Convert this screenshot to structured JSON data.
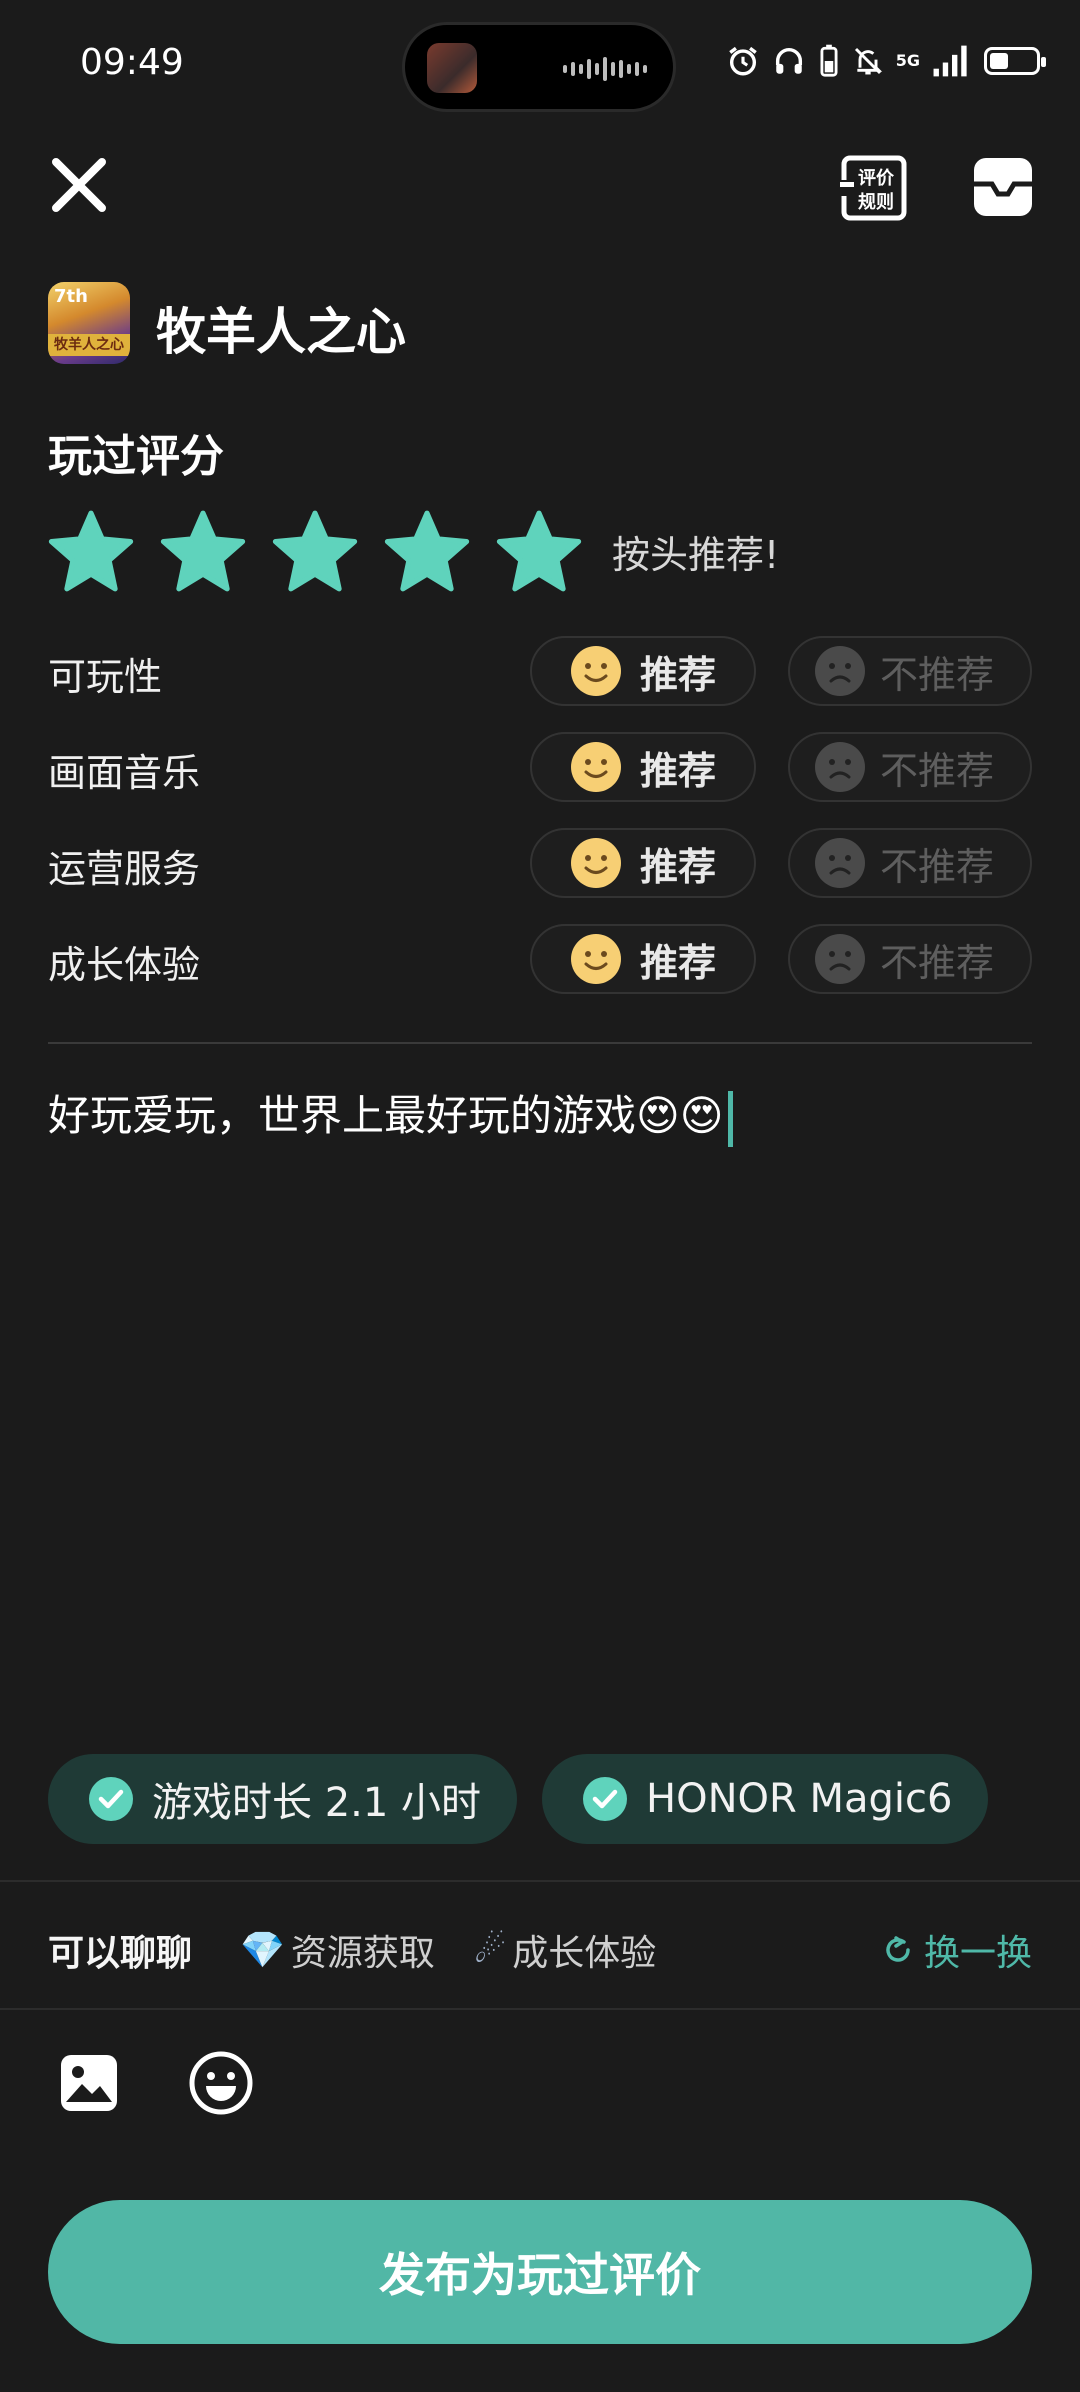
{
  "status_bar": {
    "time": "09:49",
    "network": "5G"
  },
  "game": {
    "title": "牧羊人之心",
    "icon_badge": "7th",
    "icon_caption": "牧羊人之心"
  },
  "rating": {
    "section_title": "玩过评分",
    "stars": 5,
    "max_stars": 5,
    "hint": "按头推荐!",
    "accent_color": "#5fd3bc"
  },
  "aspects": [
    {
      "label": "可玩性",
      "yes_label": "推荐",
      "no_label": "不推荐",
      "selected": "yes"
    },
    {
      "label": "画面音乐",
      "yes_label": "推荐",
      "no_label": "不推荐",
      "selected": "yes"
    },
    {
      "label": "运营服务",
      "yes_label": "推荐",
      "no_label": "不推荐",
      "selected": "yes"
    },
    {
      "label": "成长体验",
      "yes_label": "推荐",
      "no_label": "不推荐",
      "selected": "yes"
    }
  ],
  "review": {
    "text": "好玩爱玩，世界上最好玩的游戏😍😍"
  },
  "chips": [
    {
      "label": "游戏时长 2.1 小时"
    },
    {
      "label": "HONOR Magic6"
    }
  ],
  "topics": {
    "label": "可以聊聊",
    "items": [
      {
        "icon": "💎",
        "label": "资源获取"
      },
      {
        "icon": "☄",
        "label": "成长体验"
      }
    ],
    "refresh_label": "换一换"
  },
  "publish_button": {
    "label": "发布为玩过评价",
    "color": "#51b7a6"
  },
  "icons": [
    "close-icon",
    "rating-rules-icon",
    "message-icon",
    "image-icon",
    "emoji-icon"
  ]
}
